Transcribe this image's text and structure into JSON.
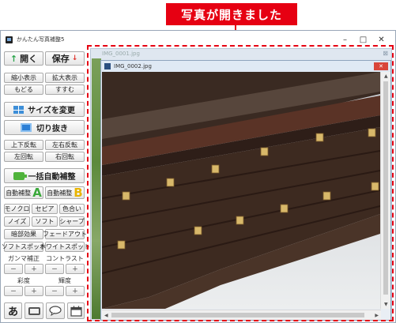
{
  "callout": {
    "text": "写真が開きました"
  },
  "window": {
    "title": "かんたん写真補整5",
    "controls": {
      "minimize": "–",
      "maximize": "□",
      "close": "✕"
    }
  },
  "panel": {
    "open": "開く",
    "save": "保存",
    "zoom_out": "縮小表示",
    "zoom_in": "拡大表示",
    "undo": "もどる",
    "redo": "すすむ",
    "resize": "サイズを変更",
    "crop": "切り抜き",
    "flip_v": "上下反転",
    "flip_h": "左右反転",
    "rot_left": "左回転",
    "rot_right": "右回転",
    "auto_all": "一括自動補整",
    "auto_a": "自動補整",
    "auto_a_letter": "A",
    "auto_b": "自動補整",
    "auto_b_letter": "B",
    "mono": "モノクロ",
    "sepia": "セピア",
    "tint": "色合い",
    "noise": "ノイズ",
    "soft": "ソフト",
    "sharp": "シャープ",
    "dim": "暗部効果",
    "fade": "フェードアウト",
    "soft_spot": "ソフトスポット",
    "white_spot": "ホワイトスポット",
    "gamma": "ガンマ補正",
    "contrast": "コントラスト",
    "saturation": "彩度",
    "brightness": "輝度",
    "minus": "－",
    "plus": "＋",
    "text_tool": "あ"
  },
  "images": {
    "back_title": "IMG_0001.jpg",
    "front_title": "IMG_0002.jpg"
  },
  "colors": {
    "accent": "#e60012"
  }
}
